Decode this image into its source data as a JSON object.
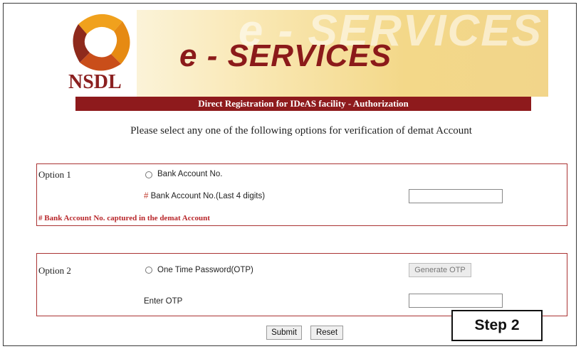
{
  "header": {
    "logo_text": "NSDL",
    "banner_title": "e - SERVICES",
    "banner_ghost": "e - SERVICES",
    "subtitle_bar": "Direct Registration for IDeAS facility - Authorization"
  },
  "intro_text": "Please select any one of the following options for verification of demat Account",
  "option1": {
    "label": "Option 1",
    "radio_label": "Bank Account No.",
    "field_hash": "#",
    "field_label": "Bank Account No.(Last 4 digits)",
    "field_value": "",
    "note": "# Bank Account No. captured in the demat Account"
  },
  "option2": {
    "label": "Option 2",
    "radio_label": "One Time Password(OTP)",
    "generate_label": "Generate OTP",
    "otp_label": "Enter OTP",
    "otp_value": ""
  },
  "buttons": {
    "submit": "Submit",
    "reset": "Reset"
  },
  "step_label": "Step 2",
  "colors": {
    "brand_red": "#8e1a1c",
    "note_red": "#b8262a",
    "banner_gold": "#f3d889"
  }
}
